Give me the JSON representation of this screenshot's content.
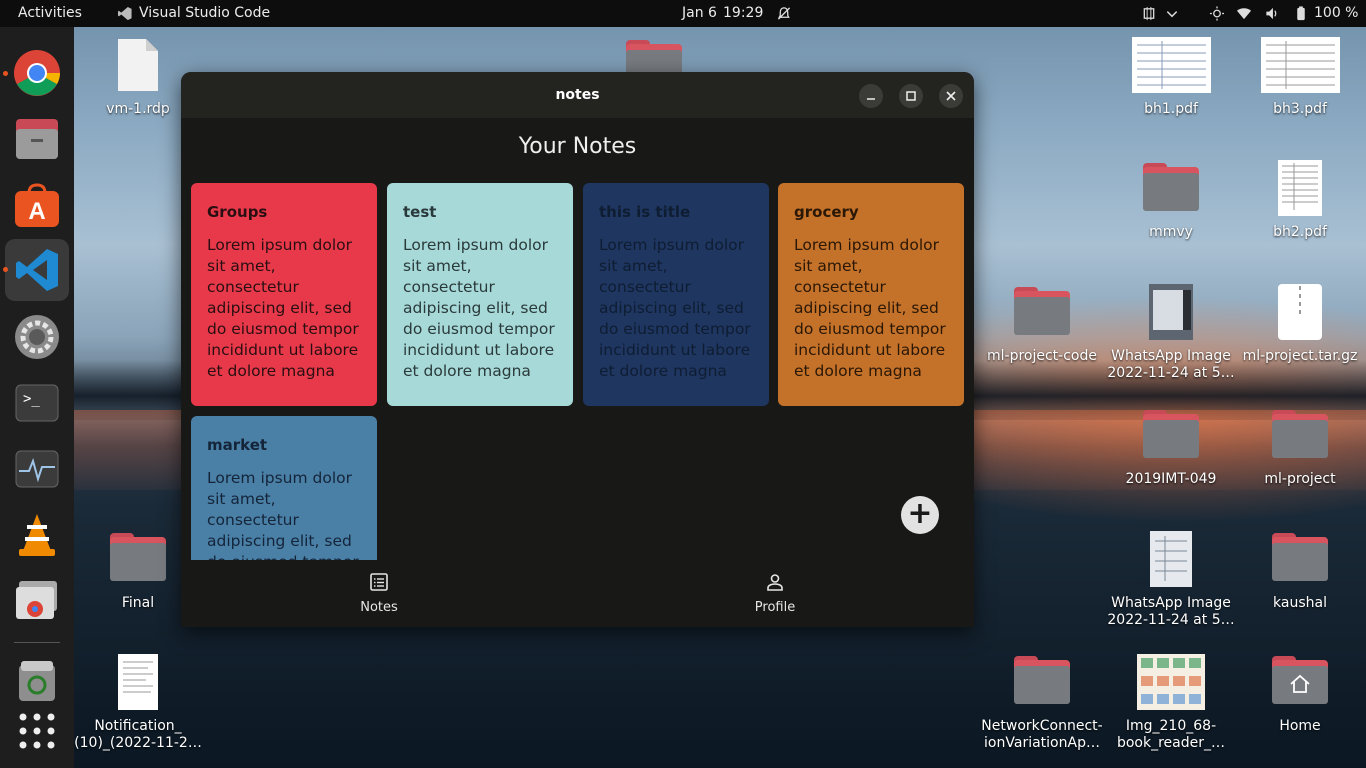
{
  "topbar": {
    "activities": "Activities",
    "app_name": "Visual Studio Code",
    "date": "Jan 6",
    "time": "19:29",
    "battery": "100 %"
  },
  "dock": {
    "apps": [
      "chrome-icon",
      "files-icon",
      "app-center-icon",
      "vscode-icon",
      "settings-icon",
      "terminal-icon",
      "system-monitor-icon",
      "vlc-icon",
      "remote-desktop-icon",
      "trash-icon",
      "show-apps-icon"
    ]
  },
  "desktop": {
    "vm_rdp": "vm-1.rdp",
    "final": "Final",
    "notification": "Notification_\n(10)_(2022-11-2…",
    "bh1": "bh1.pdf",
    "bh3": "bh3.pdf",
    "mmvy": "mmvy",
    "bh2": "bh2.pdf",
    "ml_project_code": "ml-project-code",
    "whatsapp1": "WhatsApp Image\n2022-11-24 at 5…",
    "ml_tar": "ml-project.tar.gz",
    "imt": "2019IMT-049",
    "ml_project": "ml-project",
    "whatsapp2": "WhatsApp Image\n2022-11-24 at 5…",
    "kaushal": "kaushal",
    "network": "NetworkConnect-\nionVariationAp…",
    "img210": "Img_210_68-\nbook_reader_…",
    "home": "Home"
  },
  "window": {
    "title": "notes",
    "page_title": "Your Notes",
    "fab_label": "+",
    "notes": [
      {
        "title": "Groups",
        "body": "Lorem ipsum dolor sit amet, consectetur adipiscing elit, sed do eiusmod tempor incididunt ut labore et dolore magna",
        "color": "#e8394a",
        "text_color": "#2a0f12"
      },
      {
        "title": "test",
        "body": "Lorem ipsum dolor sit amet, consectetur adipiscing elit, sed do eiusmod tempor incididunt ut labore et dolore magna",
        "color": "#a8d9d9",
        "text_color": "#2a3a3a"
      },
      {
        "title": "this is title",
        "body": "Lorem ipsum dolor sit amet, consectetur adipiscing elit, sed do eiusmod tempor incididunt ut labore et dolore magna",
        "color": "#1e3660",
        "text_color": "#0f1d33"
      },
      {
        "title": "grocery",
        "body": "Lorem ipsum dolor sit amet, consectetur adipiscing elit, sed do eiusmod tempor incididunt ut labore et dolore magna",
        "color": "#c4722a",
        "text_color": "#2a1706"
      },
      {
        "title": "market",
        "body": "Lorem ipsum dolor sit amet, consectetur adipiscing elit, sed do eiusmod tempor incididunt ut labore et dolore magna",
        "color": "#4a7fa6",
        "text_color": "#14253a"
      }
    ],
    "nav": {
      "notes": "Notes",
      "profile": "Profile"
    }
  }
}
